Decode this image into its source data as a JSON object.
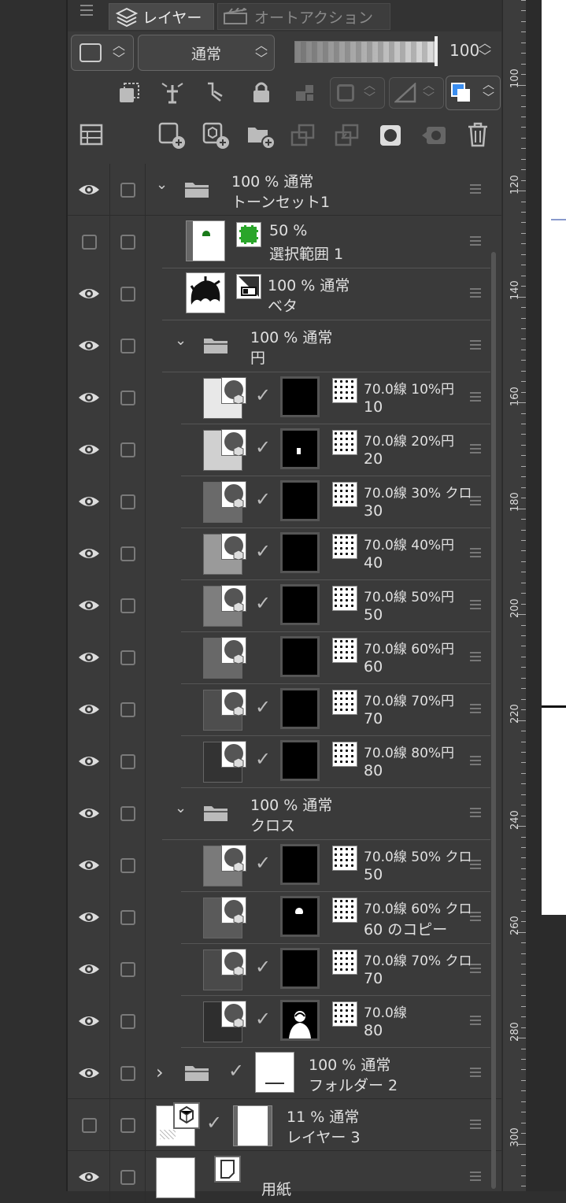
{
  "tabs": {
    "menu_icon": "menu-icon",
    "active": "レイヤー",
    "inactive": "オートアクション"
  },
  "toolbar": {
    "blend_mode": "通常",
    "opacity": "100"
  },
  "layers": [
    {
      "id": "tone-set",
      "pct": "100 % 通常",
      "name": "トーンセット1",
      "type": "folder"
    },
    {
      "id": "selection",
      "pct": "50 %",
      "name": "選択範囲 1",
      "type": "selection"
    },
    {
      "id": "beta",
      "pct": "100 % 通常",
      "name": "ベタ",
      "type": "raster"
    },
    {
      "id": "circle-folder",
      "pct": "100 % 通常",
      "name": "円",
      "type": "folder"
    },
    {
      "id": "c10",
      "pct": "70.0線 10%円",
      "name": "10"
    },
    {
      "id": "c20",
      "pct": "70.0線 20%円",
      "name": "20"
    },
    {
      "id": "c30",
      "pct": "70.0線 30% クロ",
      "name": "30"
    },
    {
      "id": "c40",
      "pct": "70.0線 40%円",
      "name": "40"
    },
    {
      "id": "c50",
      "pct": "70.0線 50%円",
      "name": "50"
    },
    {
      "id": "c60",
      "pct": "70.0線 60%円",
      "name": "60"
    },
    {
      "id": "c70",
      "pct": "70.0線 70%円",
      "name": "70"
    },
    {
      "id": "c80",
      "pct": "70.0線 80%円",
      "name": "80"
    },
    {
      "id": "cross-folder",
      "pct": "100 % 通常",
      "name": "クロス",
      "type": "folder"
    },
    {
      "id": "x50",
      "pct": "70.0線 50% クロ",
      "name": "50"
    },
    {
      "id": "x60",
      "pct": "70.0線 60% クロ",
      "name": "60 のコピー"
    },
    {
      "id": "x70",
      "pct": "70.0線 70% クロ",
      "name": "70"
    },
    {
      "id": "x80",
      "pct": "70.0線",
      "name": "80"
    },
    {
      "id": "folder2",
      "pct": "100 % 通常",
      "name": "フォルダー 2",
      "type": "folder"
    },
    {
      "id": "layer3",
      "pct": "11 % 通常",
      "name": "レイヤー 3"
    },
    {
      "id": "paper",
      "pct": "",
      "name": "用紙"
    }
  ],
  "ruler": {
    "labels": [
      "100",
      "120",
      "140",
      "160",
      "180",
      "200",
      "220",
      "240",
      "260",
      "280",
      "300"
    ]
  }
}
